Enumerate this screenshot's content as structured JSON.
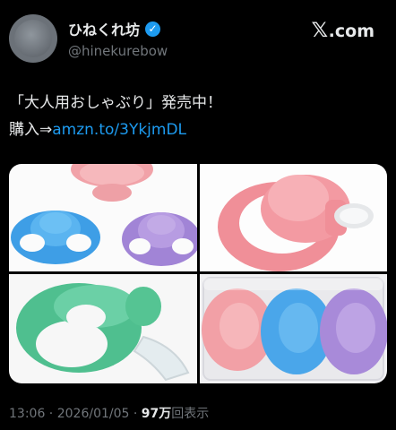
{
  "author": {
    "display_name": "ひねくれ坊",
    "handle": "@hinekurebow",
    "verified_mark": "✓"
  },
  "brand": {
    "x": "𝕏",
    "suffix": ".com"
  },
  "tweet": {
    "line1": "「大人用おしゃぶり」発売中！",
    "line2_prefix": "購入⇒",
    "link": "amzn.to/3YkjmDL"
  },
  "media": [
    {
      "name": "pacifiers-pink-blue-purple"
    },
    {
      "name": "pink-pacifier-closeup"
    },
    {
      "name": "green-pacifier-side"
    },
    {
      "name": "pacifiers-in-case"
    }
  ],
  "meta": {
    "time": "13:06",
    "sep": " · ",
    "date": "2026/01/05",
    "views_count": "97万",
    "views_label": "回表示"
  },
  "colors": {
    "background": "#000000",
    "link": "#1d9bf0",
    "muted": "#71767b",
    "pink": "#f2a3a8",
    "blue": "#4aa8ea",
    "purple": "#a88ad9",
    "green": "#5fc79c"
  }
}
